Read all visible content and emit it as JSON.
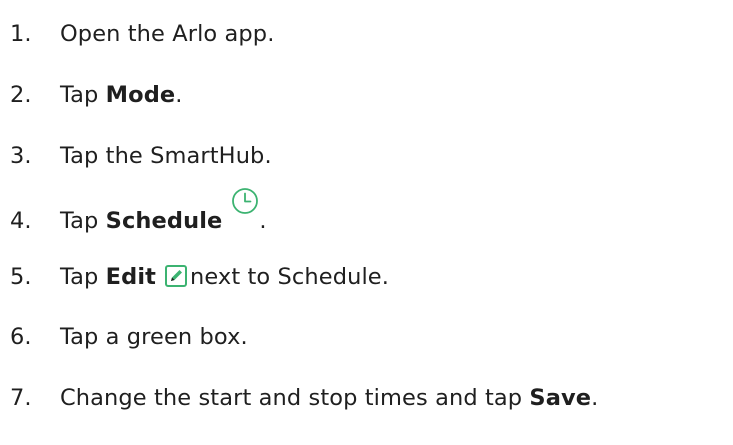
{
  "steps": [
    {
      "number": "1.",
      "text": "Open the Arlo app."
    },
    {
      "number": "2.",
      "pre": "Tap ",
      "bold": "Mode",
      "post": "."
    },
    {
      "number": "3.",
      "text": "Tap the SmartHub."
    },
    {
      "number": "4.",
      "pre": "Tap ",
      "bold": "Schedule",
      "icon": "clock-icon",
      "post": "."
    },
    {
      "number": "5.",
      "pre": "Tap ",
      "bold": "Edit",
      "icon": "edit-icon",
      "post": "next to Schedule."
    },
    {
      "number": "6.",
      "text": "Tap a green box."
    },
    {
      "number": "7.",
      "pre": "Change the start and stop times and tap ",
      "bold": "Save",
      "post": "."
    }
  ],
  "colors": {
    "text": "#1f1f1f",
    "icon_green": "#3cb371"
  }
}
